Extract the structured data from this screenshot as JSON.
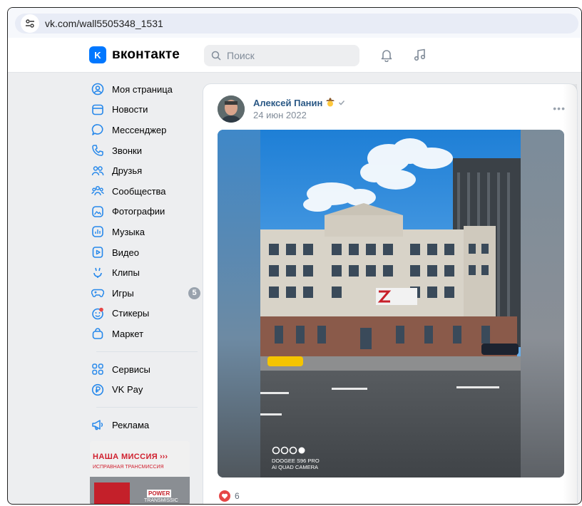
{
  "browser": {
    "url": "vk.com/wall5505348_1531"
  },
  "header": {
    "logo_mark": "K",
    "logo_text": "вконтакте",
    "search_placeholder": "Поиск"
  },
  "sidebar": {
    "items": [
      {
        "label": "Моя страница",
        "icon": "user-circle-icon"
      },
      {
        "label": "Новости",
        "icon": "news-icon"
      },
      {
        "label": "Мессенджер",
        "icon": "message-icon"
      },
      {
        "label": "Звонки",
        "icon": "phone-icon"
      },
      {
        "label": "Друзья",
        "icon": "friends-icon"
      },
      {
        "label": "Сообщества",
        "icon": "communities-icon"
      },
      {
        "label": "Фотографии",
        "icon": "photo-icon"
      },
      {
        "label": "Музыка",
        "icon": "music-icon"
      },
      {
        "label": "Видео",
        "icon": "video-icon"
      },
      {
        "label": "Клипы",
        "icon": "clips-icon"
      },
      {
        "label": "Игры",
        "icon": "gamepad-icon",
        "badge": "5"
      },
      {
        "label": "Стикеры",
        "icon": "sticker-icon"
      },
      {
        "label": "Маркет",
        "icon": "bag-icon"
      }
    ],
    "items2": [
      {
        "label": "Сервисы",
        "icon": "services-icon"
      },
      {
        "label": "VK Pay",
        "icon": "pay-icon"
      }
    ],
    "items3": [
      {
        "label": "Реклама",
        "icon": "megaphone-icon"
      }
    ],
    "ad": {
      "line1": "НАША МИССИЯ",
      "line2": "ИСПРАВНАЯ ТРАНСМИССИЯ",
      "brand1": "POWER",
      "brand2": "TRANSMISSIC"
    }
  },
  "post": {
    "author": "Алексей Панин",
    "date": "24 июн 2022",
    "photo": {
      "camera_line1": "DOOGEE S96 PRO",
      "camera_line2": "AI QUAD CAMERA"
    },
    "likes": "6"
  },
  "colors": {
    "accent": "#0077ff",
    "link": "#2a5885",
    "like": "#e64646"
  }
}
